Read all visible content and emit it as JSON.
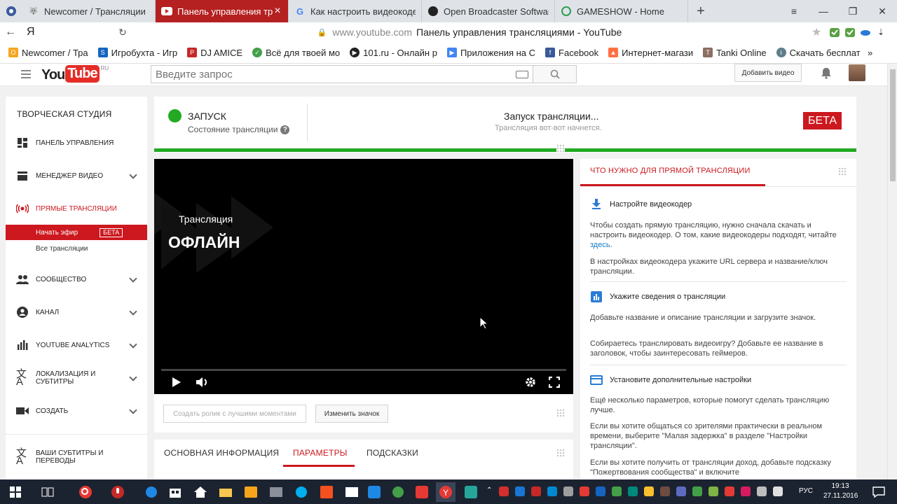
{
  "browser": {
    "tabs": [
      {
        "label": "Newcomer / Трансляции",
        "active": false
      },
      {
        "label": "Панель управления трансляциями - YouTube",
        "active": true
      },
      {
        "label": "Как настроить видеокодер",
        "active": false
      },
      {
        "label": "Open Broadcaster Software",
        "active": false
      },
      {
        "label": "GAMESHOW - Home",
        "active": false
      }
    ],
    "ya_label": "Я",
    "url_domain": "www.youtube.com",
    "url_title": "Панель управления трансляциями - YouTube",
    "bookmarks": [
      {
        "label": "Newcomer / Тра",
        "color": "#f5a623"
      },
      {
        "label": "Игробухта - Игр",
        "color": "#1565c0"
      },
      {
        "label": "DJ AMICE",
        "color": "#c62828"
      },
      {
        "label": "Всё для твоей мо",
        "color": "#43a047"
      },
      {
        "label": "101.ru - Онлайн р",
        "color": "#222222"
      },
      {
        "label": "Приложения на С",
        "color": "#4285f4"
      },
      {
        "label": "Facebook",
        "color": "#3b5998"
      },
      {
        "label": "Интернет-магази",
        "color": "#ff7043"
      },
      {
        "label": "Tanki Online",
        "color": "#8d6e63"
      },
      {
        "label": "Скачать бесплат",
        "color": "#607d8b"
      }
    ]
  },
  "header": {
    "logo_you": "You",
    "logo_tube": "Tube",
    "logo_region": "RU",
    "search_placeholder": "Введите запрос",
    "upload_label": "Добавить видео"
  },
  "sidebar": {
    "studio_label": "ТВОРЧЕСКАЯ СТУДИЯ",
    "items": [
      {
        "label": "ПАНЕЛЬ УПРАВЛЕНИЯ",
        "icon": "dashboard-icon"
      },
      {
        "label": "МЕНЕДЖЕР ВИДЕО",
        "icon": "video-manager-icon"
      },
      {
        "label": "ПРЯМЫЕ ТРАНСЛЯЦИИ",
        "icon": "live-icon"
      },
      {
        "label": "СООБЩЕСТВО",
        "icon": "community-icon"
      },
      {
        "label": "КАНАЛ",
        "icon": "channel-icon"
      },
      {
        "label": "YOUTUBE ANALYTICS",
        "icon": "analytics-icon"
      },
      {
        "label": "ЛОКАЛИЗАЦИЯ И СУБТИТРЫ",
        "icon": "translate-icon"
      },
      {
        "label": "СОЗДАТЬ",
        "icon": "create-icon"
      },
      {
        "label": "ВАШИ СУБТИТРЫ И ПЕРЕВОДЫ",
        "icon": "subtitles-icon"
      }
    ],
    "live_sub": [
      {
        "label": "Начать эфир",
        "badge": "БЕТА",
        "active": true
      },
      {
        "label": "Все трансляции",
        "active": false
      }
    ]
  },
  "status": {
    "state": "ЗАПУСК",
    "state_sub": "Состояние трансляции",
    "message": "Запуск трансляции...",
    "message_sub": "Трансляция вот-вот начнется.",
    "beta": "БЕТА",
    "status_color": "#22aa22"
  },
  "player": {
    "top_label": "Трансляция",
    "big_label": "ОФЛАЙН"
  },
  "actions": {
    "highlights_label": "Создать ролик с лучшими моментами",
    "thumbnail_label": "Изменить значок"
  },
  "tabs": [
    {
      "label": "ОСНОВНАЯ ИНФОРМАЦИЯ",
      "active": false
    },
    {
      "label": "ПАРАМЕТРЫ",
      "active": true
    },
    {
      "label": "ПОДСКАЗКИ",
      "active": false
    }
  ],
  "requirements": {
    "title": "ЧТО НУЖНО ДЛЯ ПРЯМОЙ ТРАНСЛЯЦИИ",
    "s1_title": "Настройте видеокодер",
    "s1_p1_a": "Чтобы создать прямую трансляцию, нужно сначала скачать и настроить видеокодер. О том, какие видеокодеры подходят, читайте ",
    "s1_p1_link": "здесь",
    "s1_p1_b": ".",
    "s1_p2": "В настройках видеокодера укажите URL сервера и название/ключ трансляции.",
    "s2_title": "Укажите сведения о трансляции",
    "s2_p1": "Добавьте название и описание трансляции и загрузите значок.",
    "s2_p2": "Собираетесь транслировать видеоигру? Добавьте ее название в заголовок, чтобы заинтересовать геймеров.",
    "s3_title": "Установите дополнительные настройки",
    "s3_p1": "Ещё несколько параметров, которые помогут сделать трансляцию лучше.",
    "s3_p2": "Если вы хотите общаться со зрителями практически в реальном времени, выберите \"Малая задержка\" в разделе \"Настройки трансляции\".",
    "s3_p3": "Если вы хотите получить от трансляции доход, добавьте подсказку \"Пожертвования сообщества\" и включите"
  },
  "taskbar": {
    "lang": "РУС",
    "time": "19:13",
    "date": "27.11.2016"
  }
}
